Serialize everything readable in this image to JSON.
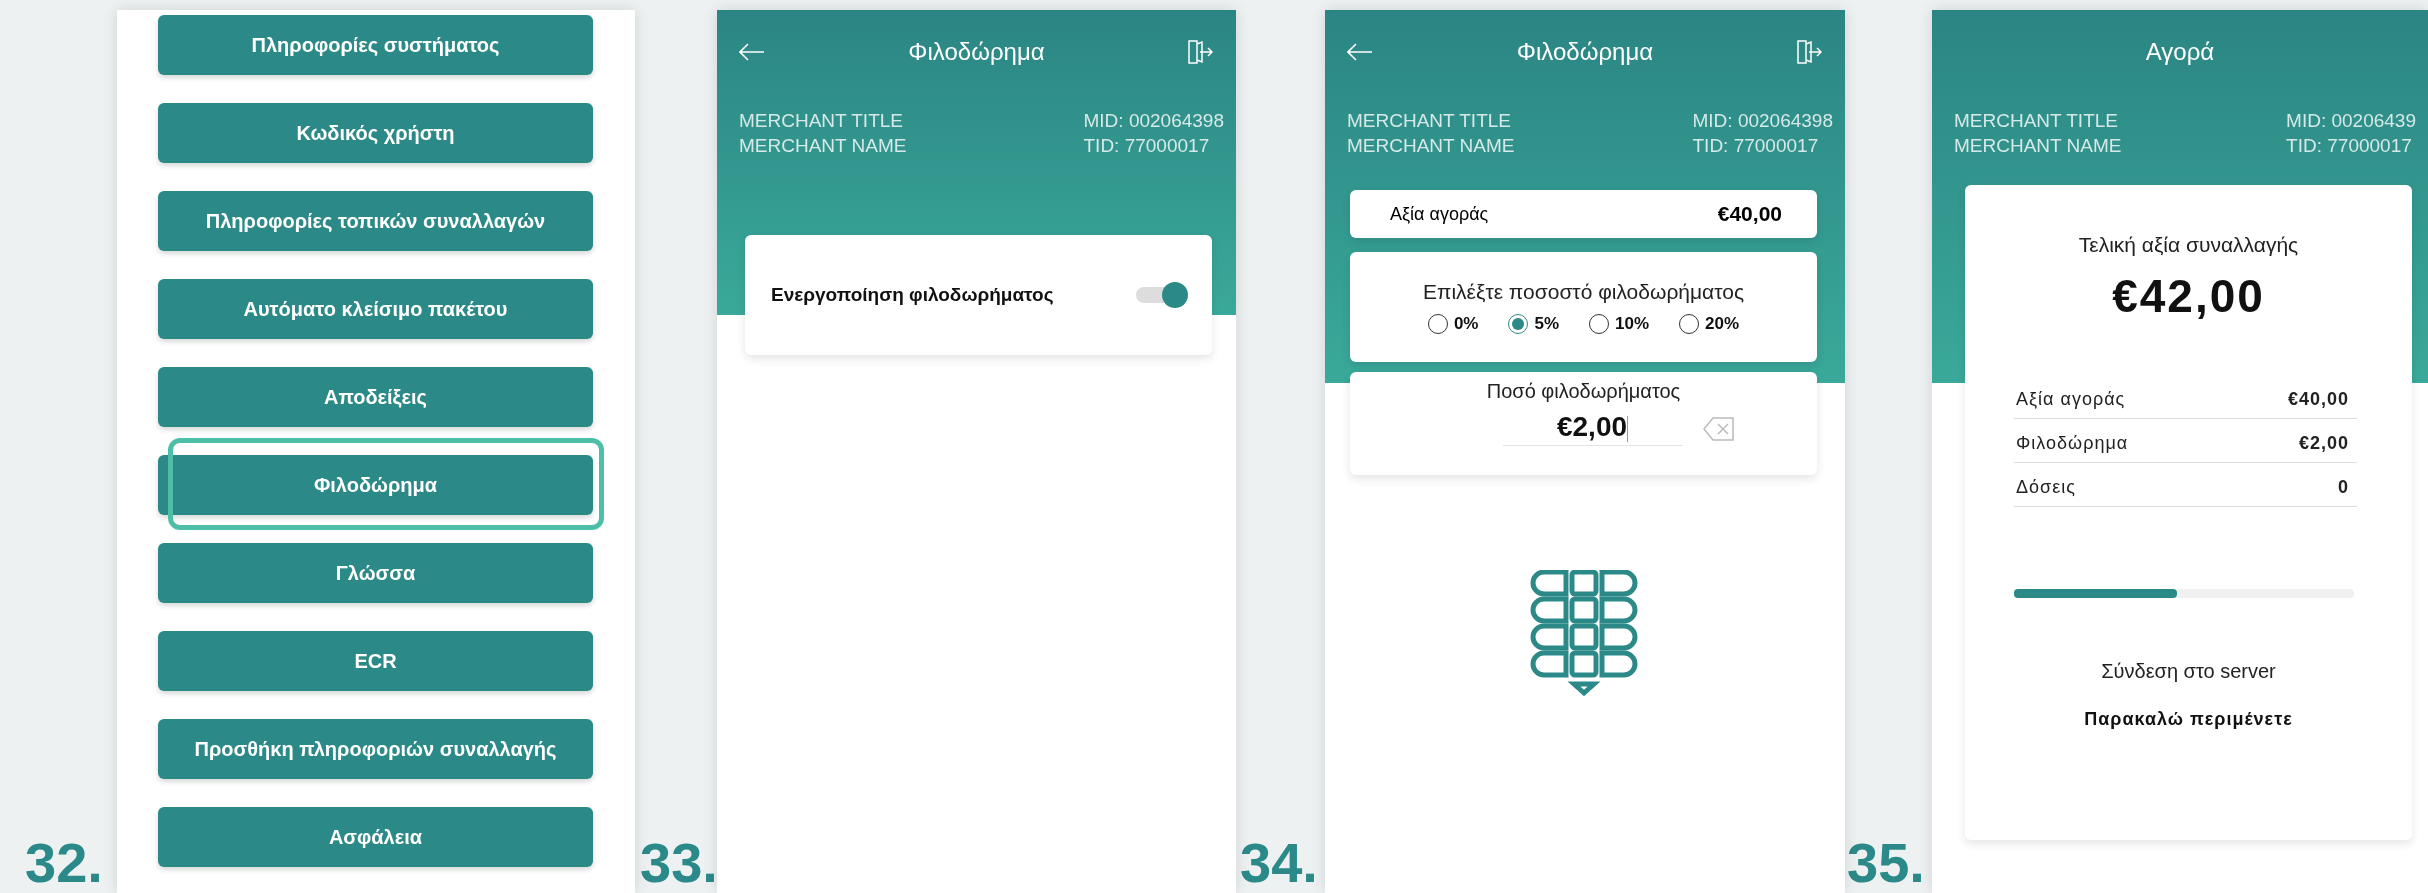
{
  "screens": [
    {
      "number": "32.",
      "kind": "menu",
      "menu_items": [
        {
          "label": "Πληροφορίες συστήματος",
          "highlighted": false
        },
        {
          "label": "Κωδικός χρήστη",
          "highlighted": false
        },
        {
          "label": "Πληροφορίες τοπικών συναλλαγών",
          "highlighted": false
        },
        {
          "label": "Αυτόματο κλείσιμο πακέτου",
          "highlighted": false
        },
        {
          "label": "Αποδείξεις",
          "highlighted": false
        },
        {
          "label": "Φιλοδώρημα",
          "highlighted": true
        },
        {
          "label": "Γλώσσα",
          "highlighted": false
        },
        {
          "label": "ECR",
          "highlighted": false
        },
        {
          "label": "Προσθήκη πληροφοριών συναλλαγής",
          "highlighted": false
        },
        {
          "label": "Ασφάλεια",
          "highlighted": false
        }
      ]
    },
    {
      "number": "33.",
      "kind": "toggle",
      "header": {
        "title": "Φιλοδώρημα",
        "nav_icons": true,
        "merchant_title": "MERCHANT TITLE",
        "merchant_name": "MERCHANT NAME",
        "mid": "MID: 002064398",
        "tid": "TID: 77000017"
      },
      "setting": {
        "label": "Ενεργοποίηση φιλοδωρήματος",
        "on": true
      }
    },
    {
      "number": "34.",
      "kind": "tip",
      "header": {
        "title": "Φιλοδώρημα",
        "nav_icons": true,
        "merchant_title": "MERCHANT TITLE",
        "merchant_name": "MERCHANT NAME",
        "mid": "MID: 002064398",
        "tid": "TID: 77000017"
      },
      "purchase": {
        "label": "Αξία αγοράς",
        "value": "€40,00"
      },
      "percent_prompt": "Επιλέξτε ποσοστό φιλοδωρήματος",
      "options": [
        {
          "label": "0%",
          "selected": false
        },
        {
          "label": "5%",
          "selected": true
        },
        {
          "label": "10%",
          "selected": false
        },
        {
          "label": "20%",
          "selected": false
        }
      ],
      "tip_amount": {
        "label": "Ποσό φιλοδωρήματος",
        "value": "€2,00"
      }
    },
    {
      "number": "35.",
      "kind": "summary",
      "header": {
        "title": "Αγορά",
        "nav_icons": false,
        "merchant_title": "MERCHANT TITLE",
        "merchant_name": "MERCHANT NAME",
        "mid": "MID: 00206439",
        "tid": "TID: 77000017"
      },
      "total_label": "Τελική αξία συναλλαγής",
      "total": "€42,00",
      "rows": [
        {
          "label": "Αξία αγοράς",
          "value": "€40,00"
        },
        {
          "label": "Φιλοδώρημα",
          "value": "€2,00"
        },
        {
          "label": "Δόσεις",
          "value": "0"
        }
      ],
      "progress": {
        "level": 0.48
      },
      "status": "Σύνδεση στο server",
      "wait": "Παρακαλώ περιμένετε"
    }
  ]
}
